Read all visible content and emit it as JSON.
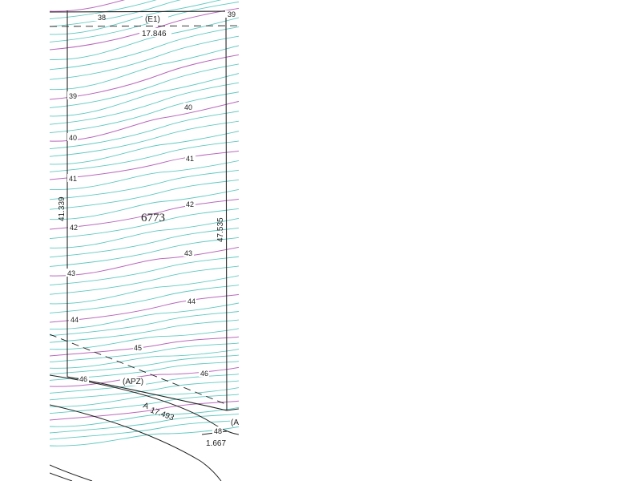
{
  "lot": {
    "number": "6773"
  },
  "easements": {
    "top": "(E1)",
    "apz": "(APZ)",
    "right_cut": "(A"
  },
  "dimensions": {
    "top": "17.846",
    "left": "41.339",
    "right": "47.535",
    "bottom_curve": "17.493",
    "bottom_short": "1.667",
    "bottom_prefix": "A"
  },
  "contour_labels": {
    "c38": "38",
    "c39_top": "39",
    "c39": "39",
    "c40_left": "40",
    "c40_right": "40",
    "c41_left": "41",
    "c41_right": "41",
    "c42_left": "42",
    "c42_right": "42",
    "c43_left": "43",
    "c43_right": "43",
    "c44_left": "44",
    "c44_right": "44",
    "c45": "45",
    "c46_left": "46",
    "c46_right": "46",
    "c48": "48"
  },
  "colors": {
    "minor_contour": "#5fc9c2",
    "major_contour": "#b968bd",
    "linework": "#222222",
    "background": "#ffffff"
  },
  "contour_interval_major": 1,
  "contour_range": [
    38,
    48
  ]
}
